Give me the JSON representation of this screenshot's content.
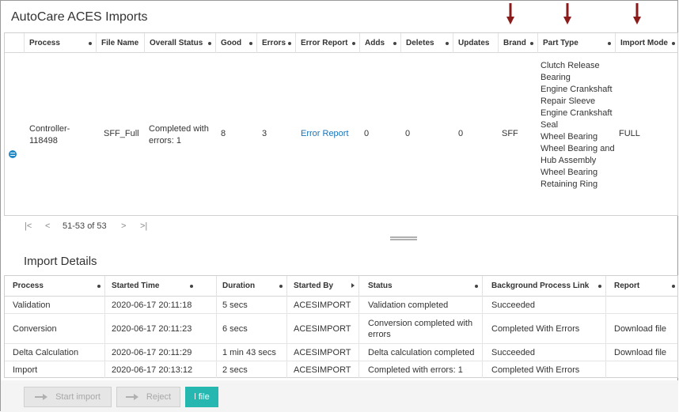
{
  "window": {
    "title": "AutoCare ACES Imports"
  },
  "colors": {
    "accent": "#26b8b0",
    "link": "#1a73b5",
    "annotation_arrow": "#8b1a1a",
    "row_icon": "#1e88c8"
  },
  "imports_grid": {
    "columns": [
      "Process",
      "File Name",
      "Overall Status",
      "Good",
      "Errors",
      "Error Report",
      "Adds",
      "Deletes",
      "Updates",
      "Brand",
      "Part Type",
      "Import Mode"
    ],
    "row": {
      "icon": "list-icon",
      "process": "Controller-\n118498",
      "file_name": "SFF_Full",
      "overall_status": "Completed with errors: 1",
      "good": "8",
      "errors": "3",
      "error_report": "Error Report",
      "adds": "0",
      "deletes": "0",
      "updates": "0",
      "brand": "SFF",
      "part_types": [
        "Clutch Release Bearing",
        "Engine Crankshaft Repair Sleeve",
        "Engine Crankshaft Seal",
        "Wheel Bearing",
        "Wheel Bearing and Hub Assembly",
        "Wheel Bearing Retaining Ring"
      ],
      "import_mode": "FULL"
    }
  },
  "pager": {
    "first": "|<",
    "prev": "<",
    "count": "51-53 of 53",
    "next": ">",
    "last": ">|"
  },
  "details": {
    "title": "Import Details",
    "columns": [
      "Process",
      "Started Time",
      "Duration",
      "Started By",
      "Status",
      "Background Process Link",
      "Report"
    ],
    "rows": [
      {
        "process": "Validation",
        "started_time": "2020-06-17 20:11:18",
        "duration": "5 secs",
        "started_by": "ACESIMPORT",
        "status": "Validation completed",
        "link": "Succeeded",
        "report": ""
      },
      {
        "process": "Conversion",
        "started_time": "2020-06-17 20:11:23",
        "duration": "6 secs",
        "started_by": "ACESIMPORT",
        "status": "Conversion completed with errors",
        "link": "Completed With Errors",
        "report": "Download file"
      },
      {
        "process": "Delta Calculation",
        "started_time": "2020-06-17 20:11:29",
        "duration": "1 min 43 secs",
        "started_by": "ACESIMPORT",
        "status": "Delta calculation completed",
        "link": "Succeeded",
        "report": "Download file"
      },
      {
        "process": "Import",
        "started_time": "2020-06-17 20:13:12",
        "duration": "2 secs",
        "started_by": "ACESIMPORT",
        "status": "Completed with errors: 1",
        "link": "Completed With Errors",
        "report": ""
      }
    ]
  },
  "footer": {
    "start_import": "Start import",
    "reject": "Reject",
    "file": "l file"
  }
}
